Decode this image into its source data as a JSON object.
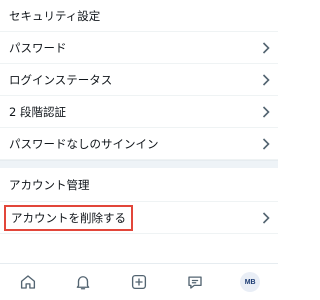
{
  "security": {
    "title": "セキュリティ設定",
    "items": [
      {
        "label": "パスワード"
      },
      {
        "label": "ログインステータス"
      },
      {
        "label": "2 段階認証"
      },
      {
        "label": "パスワードなしのサインイン"
      }
    ]
  },
  "account": {
    "title": "アカウント管理",
    "delete_label": "アカウントを削除する"
  },
  "bottom_nav": {
    "items": [
      "home-icon",
      "bell-icon",
      "plus-square-icon",
      "chat-icon"
    ],
    "avatar_initials": "MB"
  },
  "colors": {
    "highlight_border": "#e2463a",
    "divider": "#eef3f7",
    "avatar_bg": "#e9eef6",
    "avatar_text": "#1d3c73"
  }
}
